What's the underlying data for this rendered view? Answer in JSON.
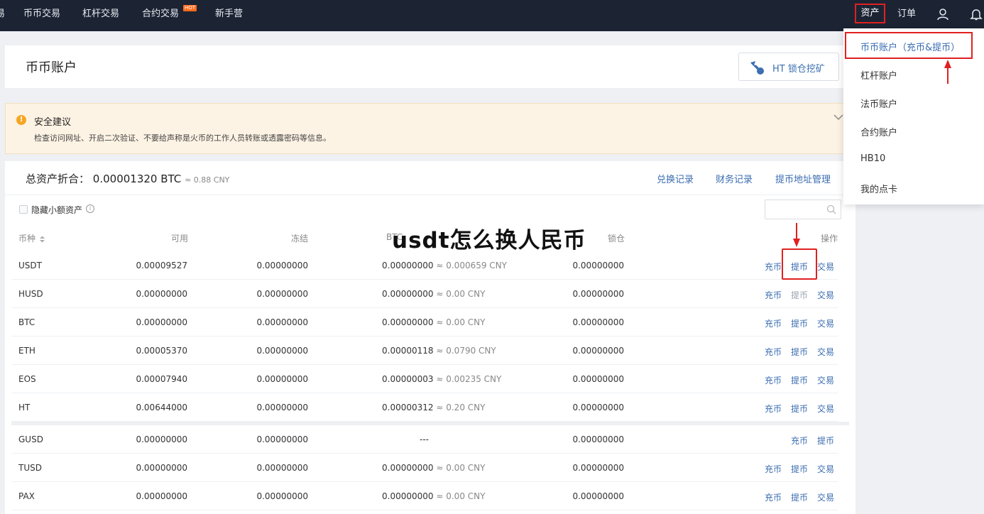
{
  "nav": {
    "left_items": [
      {
        "label": "易"
      },
      {
        "label": "币币交易"
      },
      {
        "label": "杠杆交易"
      },
      {
        "label": "合约交易",
        "badge": "HOT"
      },
      {
        "label": "新手营"
      }
    ],
    "assets": "资产",
    "orders": "订单"
  },
  "header": {
    "title": "币币账户",
    "ht_button": "HT 锁仓挖矿"
  },
  "notice": {
    "title": "安全建议",
    "text": "检查访问网址、开启二次验证、不要给声称是火币的工作人员转账或透露密码等信息。"
  },
  "summary": {
    "label": "总资产折合：",
    "btc": "0.00001320 BTC",
    "cny": "≈ 0.88 CNY",
    "links": [
      "兑换记录",
      "财务记录",
      "提币地址管理"
    ]
  },
  "filter": {
    "hide_small_label": "隐藏小额资产",
    "search_placeholder": ""
  },
  "table": {
    "headers": {
      "coin": "币种",
      "available": "可用",
      "frozen": "冻结",
      "btc_value": "BTC",
      "locked": "锁仓",
      "actions": "操作"
    },
    "rows": [
      {
        "coin": "USDT",
        "available": "0.00009527",
        "frozen": "0.00000000",
        "btc": "0.00000000",
        "cny": "≈ 0.000659 CNY",
        "locked": "0.00000000",
        "actions": [
          "充币",
          "提币",
          "交易"
        ]
      },
      {
        "coin": "HUSD",
        "available": "0.00000000",
        "frozen": "0.00000000",
        "btc": "0.00000000",
        "cny": "≈ 0.00 CNY",
        "locked": "0.00000000",
        "actions": [
          "充币",
          "提币",
          "交易"
        ]
      },
      {
        "coin": "BTC",
        "available": "0.00000000",
        "frozen": "0.00000000",
        "btc": "0.00000000",
        "cny": "≈ 0.00 CNY",
        "locked": "0.00000000",
        "actions": [
          "充币",
          "提币",
          "交易"
        ]
      },
      {
        "coin": "ETH",
        "available": "0.00005370",
        "frozen": "0.00000000",
        "btc": "0.00000118",
        "cny": "≈ 0.0790 CNY",
        "locked": "0.00000000",
        "actions": [
          "充币",
          "提币",
          "交易"
        ]
      },
      {
        "coin": "EOS",
        "available": "0.00007940",
        "frozen": "0.00000000",
        "btc": "0.00000003",
        "cny": "≈ 0.00235 CNY",
        "locked": "0.00000000",
        "actions": [
          "充币",
          "提币",
          "交易"
        ]
      },
      {
        "coin": "HT",
        "available": "0.00644000",
        "frozen": "0.00000000",
        "btc": "0.00000312",
        "cny": "≈ 0.20 CNY",
        "locked": "0.00000000",
        "actions": [
          "充币",
          "提币",
          "交易"
        ]
      },
      {
        "coin": "GUSD",
        "available": "0.00000000",
        "frozen": "0.00000000",
        "btc": "---",
        "cny": "",
        "locked": "0.00000000",
        "actions": [
          "充币",
          "提币"
        ]
      },
      {
        "coin": "TUSD",
        "available": "0.00000000",
        "frozen": "0.00000000",
        "btc": "0.00000000",
        "cny": "≈ 0.00 CNY",
        "locked": "0.00000000",
        "actions": [
          "充币",
          "提币",
          "交易"
        ]
      },
      {
        "coin": "PAX",
        "available": "0.00000000",
        "frozen": "0.00000000",
        "btc": "0.00000000",
        "cny": "≈ 0.00 CNY",
        "locked": "0.00000000",
        "actions": [
          "充币",
          "提币",
          "交易"
        ]
      }
    ]
  },
  "overlay_title": "usdt怎么换人民币",
  "dropdown": {
    "items": [
      "币币账户（充币&提币）",
      "杠杆账户",
      "法币账户",
      "合约账户",
      "HB10",
      "我的点卡"
    ]
  },
  "colors": {
    "nav_bg": "#1c2434",
    "link": "#3a6cb0",
    "highlight_red": "#e02020",
    "notice_bg": "#fdf3e4"
  }
}
